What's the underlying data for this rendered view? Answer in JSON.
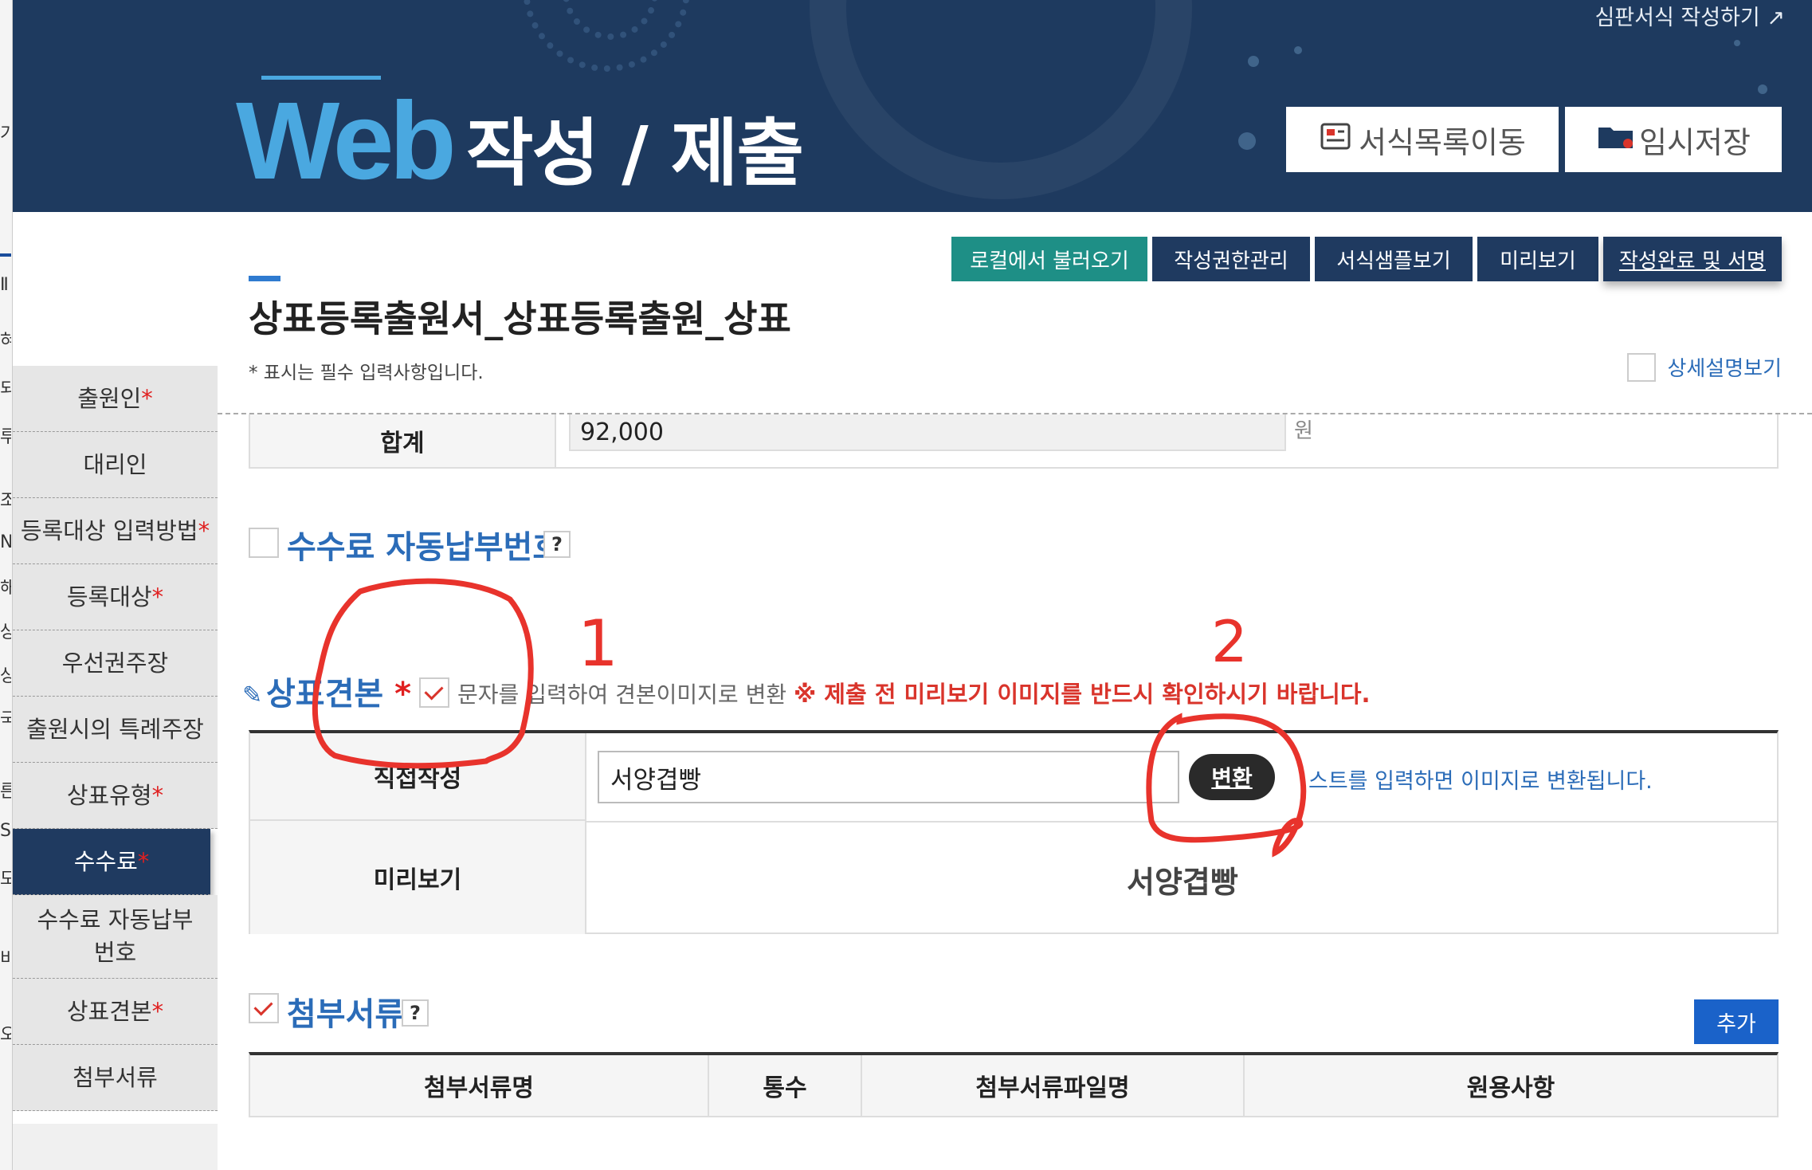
{
  "header": {
    "top_link": "심판서식 작성하기",
    "title_web": "Web",
    "title_rest": "작성 / 제출",
    "btn_form_list": "서식목록이동",
    "btn_temp_save": "임시저장"
  },
  "toolbar": {
    "load_local": "로컬에서 불러오기",
    "permission": "작성권한관리",
    "sample": "서식샘플보기",
    "preview": "미리보기",
    "complete_sign": "작성완료 및 서명"
  },
  "form": {
    "title": "상표등록출원서_상표등록출원_상표",
    "required_note": "* 표시는 필수 입력사항입니다.",
    "detail_label": "상세설명보기"
  },
  "nav": {
    "items": [
      {
        "label": "출원인",
        "required": "*"
      },
      {
        "label": "대리인",
        "required": ""
      },
      {
        "label": "등록대상 입력방법",
        "required": "*"
      },
      {
        "label": "등록대상",
        "required": "*"
      },
      {
        "label": "우선권주장",
        "required": ""
      },
      {
        "label": "출원시의 특례주장",
        "required": ""
      },
      {
        "label": "상표유형",
        "required": "*"
      },
      {
        "label": "수수료",
        "required": "*"
      },
      {
        "label": "수수료 자동납부번호",
        "required": ""
      },
      {
        "label": "상표견본",
        "required": "*"
      },
      {
        "label": "첨부서류",
        "required": ""
      }
    ]
  },
  "fee": {
    "total_label": "합계",
    "total_value": "92,000",
    "unit": "원"
  },
  "auto_pay": {
    "title": "수수료 자동납부번호",
    "help": "?"
  },
  "mark_sample": {
    "title": "상표견본",
    "required": "*",
    "option_text": "문자를 입력하여 견본이미지로 변환",
    "warning": "※ 제출 전 미리보기 이미지를 반드시 확인하시기 바랍니다.",
    "direct_label": "직접작성",
    "input_value": "서양겹빵",
    "convert_button": "변환",
    "hint": "스트를 입력하면 이미지로 변환됩니다.",
    "preview_label": "미리보기",
    "preview_value": "서양겹빵"
  },
  "attachments": {
    "title": "첨부서류",
    "help": "?",
    "add_button": "추가",
    "columns": [
      "첨부서류명",
      "통수",
      "첨부서류파일명",
      "원용사항"
    ]
  },
  "annotations": {
    "mark_1": "1",
    "mark_2": "2",
    "color": "#e8332c"
  },
  "colors": {
    "header_bg": "#1e3a5f",
    "accent_blue": "#4aa8e0",
    "nav_active": "#1f3a60",
    "toolbar_green": "#1e8f86",
    "link_blue": "#2b6cb8",
    "warning_red": "#d9342b"
  }
}
